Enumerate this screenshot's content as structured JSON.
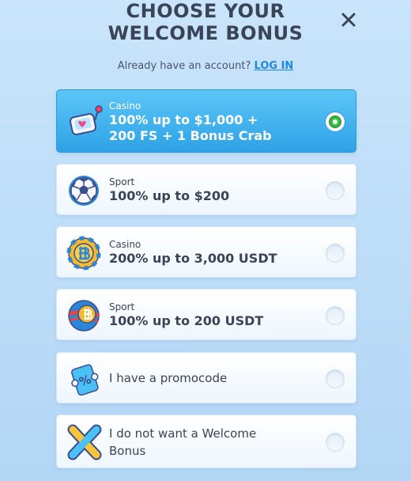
{
  "header": {
    "title_line1": "CHOOSE YOUR",
    "title_line2": "WELCOME BONUS",
    "close_icon": "close-icon"
  },
  "account": {
    "prompt": "Already have an account?",
    "login_label": "LOG IN"
  },
  "options": [
    {
      "category": "Casino",
      "value_line1": "100% up to $1,000 +",
      "value_line2": "200 FS + 1 Bonus Crab",
      "icon": "casino-slot-icon",
      "selected": true
    },
    {
      "category": "Sport",
      "value": "100% up to $200",
      "icon": "soccer-ball-icon",
      "selected": false
    },
    {
      "category": "Casino",
      "value": "200% up to 3,000 USDT",
      "icon": "bitcoin-chip-icon",
      "selected": false
    },
    {
      "category": "Sport",
      "value": "100% up to 200 USDT",
      "icon": "bitcoin-ball-icon",
      "selected": false
    },
    {
      "value": "I have a promocode",
      "icon": "promo-ticket-icon",
      "selected": false
    },
    {
      "value_line1": "I do not want a Welcome",
      "value_line2": "Bonus",
      "icon": "cross-icon",
      "selected": false
    }
  ],
  "colors": {
    "accent": "#2ea2e6",
    "selected_radio": "#3bc246",
    "link": "#1e88e5",
    "text": "#3a4456"
  }
}
